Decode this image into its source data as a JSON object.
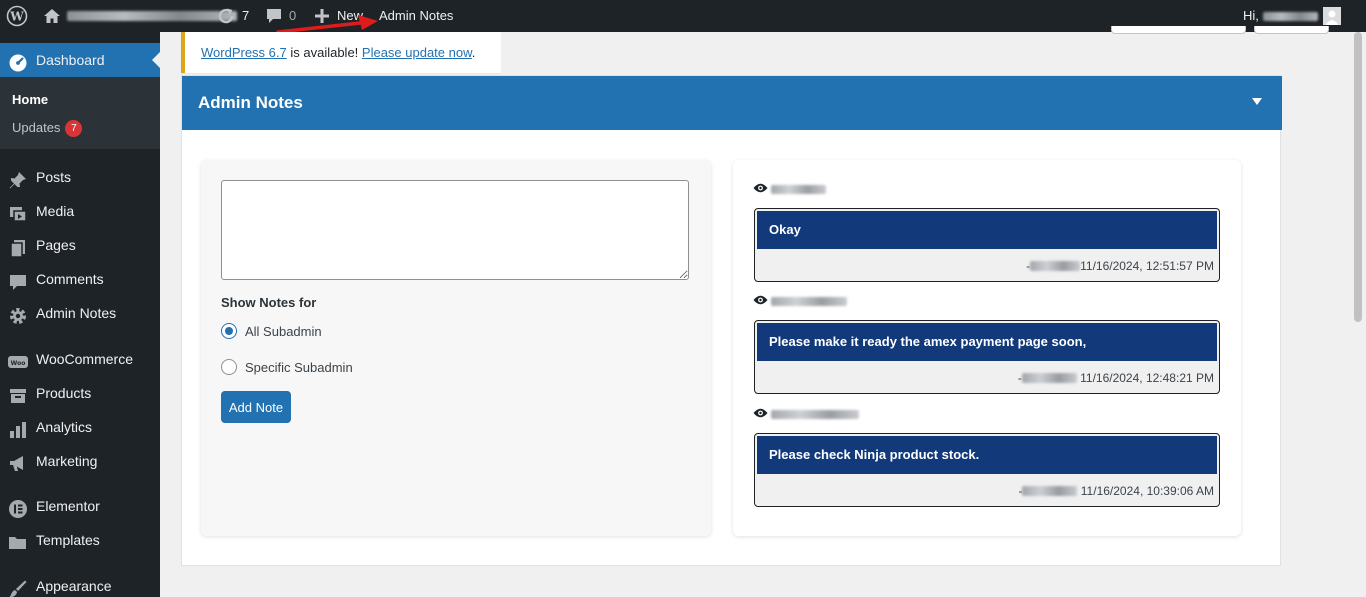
{
  "adminbar": {
    "updates_count": "7",
    "comments_count": "0",
    "new_label": "New",
    "admin_notes_label": "Admin Notes",
    "greeting": "Hi,"
  },
  "sidebar": {
    "dashboard": "Dashboard",
    "home": "Home",
    "updates": "Updates",
    "updates_badge": "7",
    "items": [
      "Posts",
      "Media",
      "Pages",
      "Comments",
      "Admin Notes",
      "WooCommerce",
      "Products",
      "Analytics",
      "Marketing",
      "Elementor",
      "Templates",
      "Appearance"
    ]
  },
  "notice": {
    "link_text": "WordPress 6.7",
    "middle_text": " is available! ",
    "update_link": "Please update now",
    "period": "."
  },
  "panel": {
    "title": "Admin Notes",
    "show_notes_for": "Show Notes for",
    "radio_all": "All Subadmin",
    "radio_specific": "Specific Subadmin",
    "selected": "All Subadmin",
    "add_button": "Add Note"
  },
  "notes": [
    {
      "message": "Okay",
      "meta_prefix": "-",
      "timestamp": "11/16/2024, 12:51:57 PM"
    },
    {
      "message": "Please make it ready the amex payment page soon,",
      "meta_prefix": "-",
      "timestamp": " 11/16/2024, 12:48:21 PM"
    },
    {
      "message": "Please check Ninja product stock.",
      "meta_prefix": "-",
      "timestamp": " 11/16/2024, 10:39:06 AM"
    }
  ],
  "colors": {
    "adminbar_bg": "#1d2327",
    "accent": "#2271b1",
    "note_bg": "#123a7a",
    "notice_border": "#dba617",
    "badge": "#d63638"
  },
  "icons": {
    "logo": "wordpress-logo-icon",
    "home": "home-icon",
    "updates": "refresh-icon",
    "comments": "comment-icon",
    "new": "plus-icon",
    "eye": "eye-icon"
  }
}
